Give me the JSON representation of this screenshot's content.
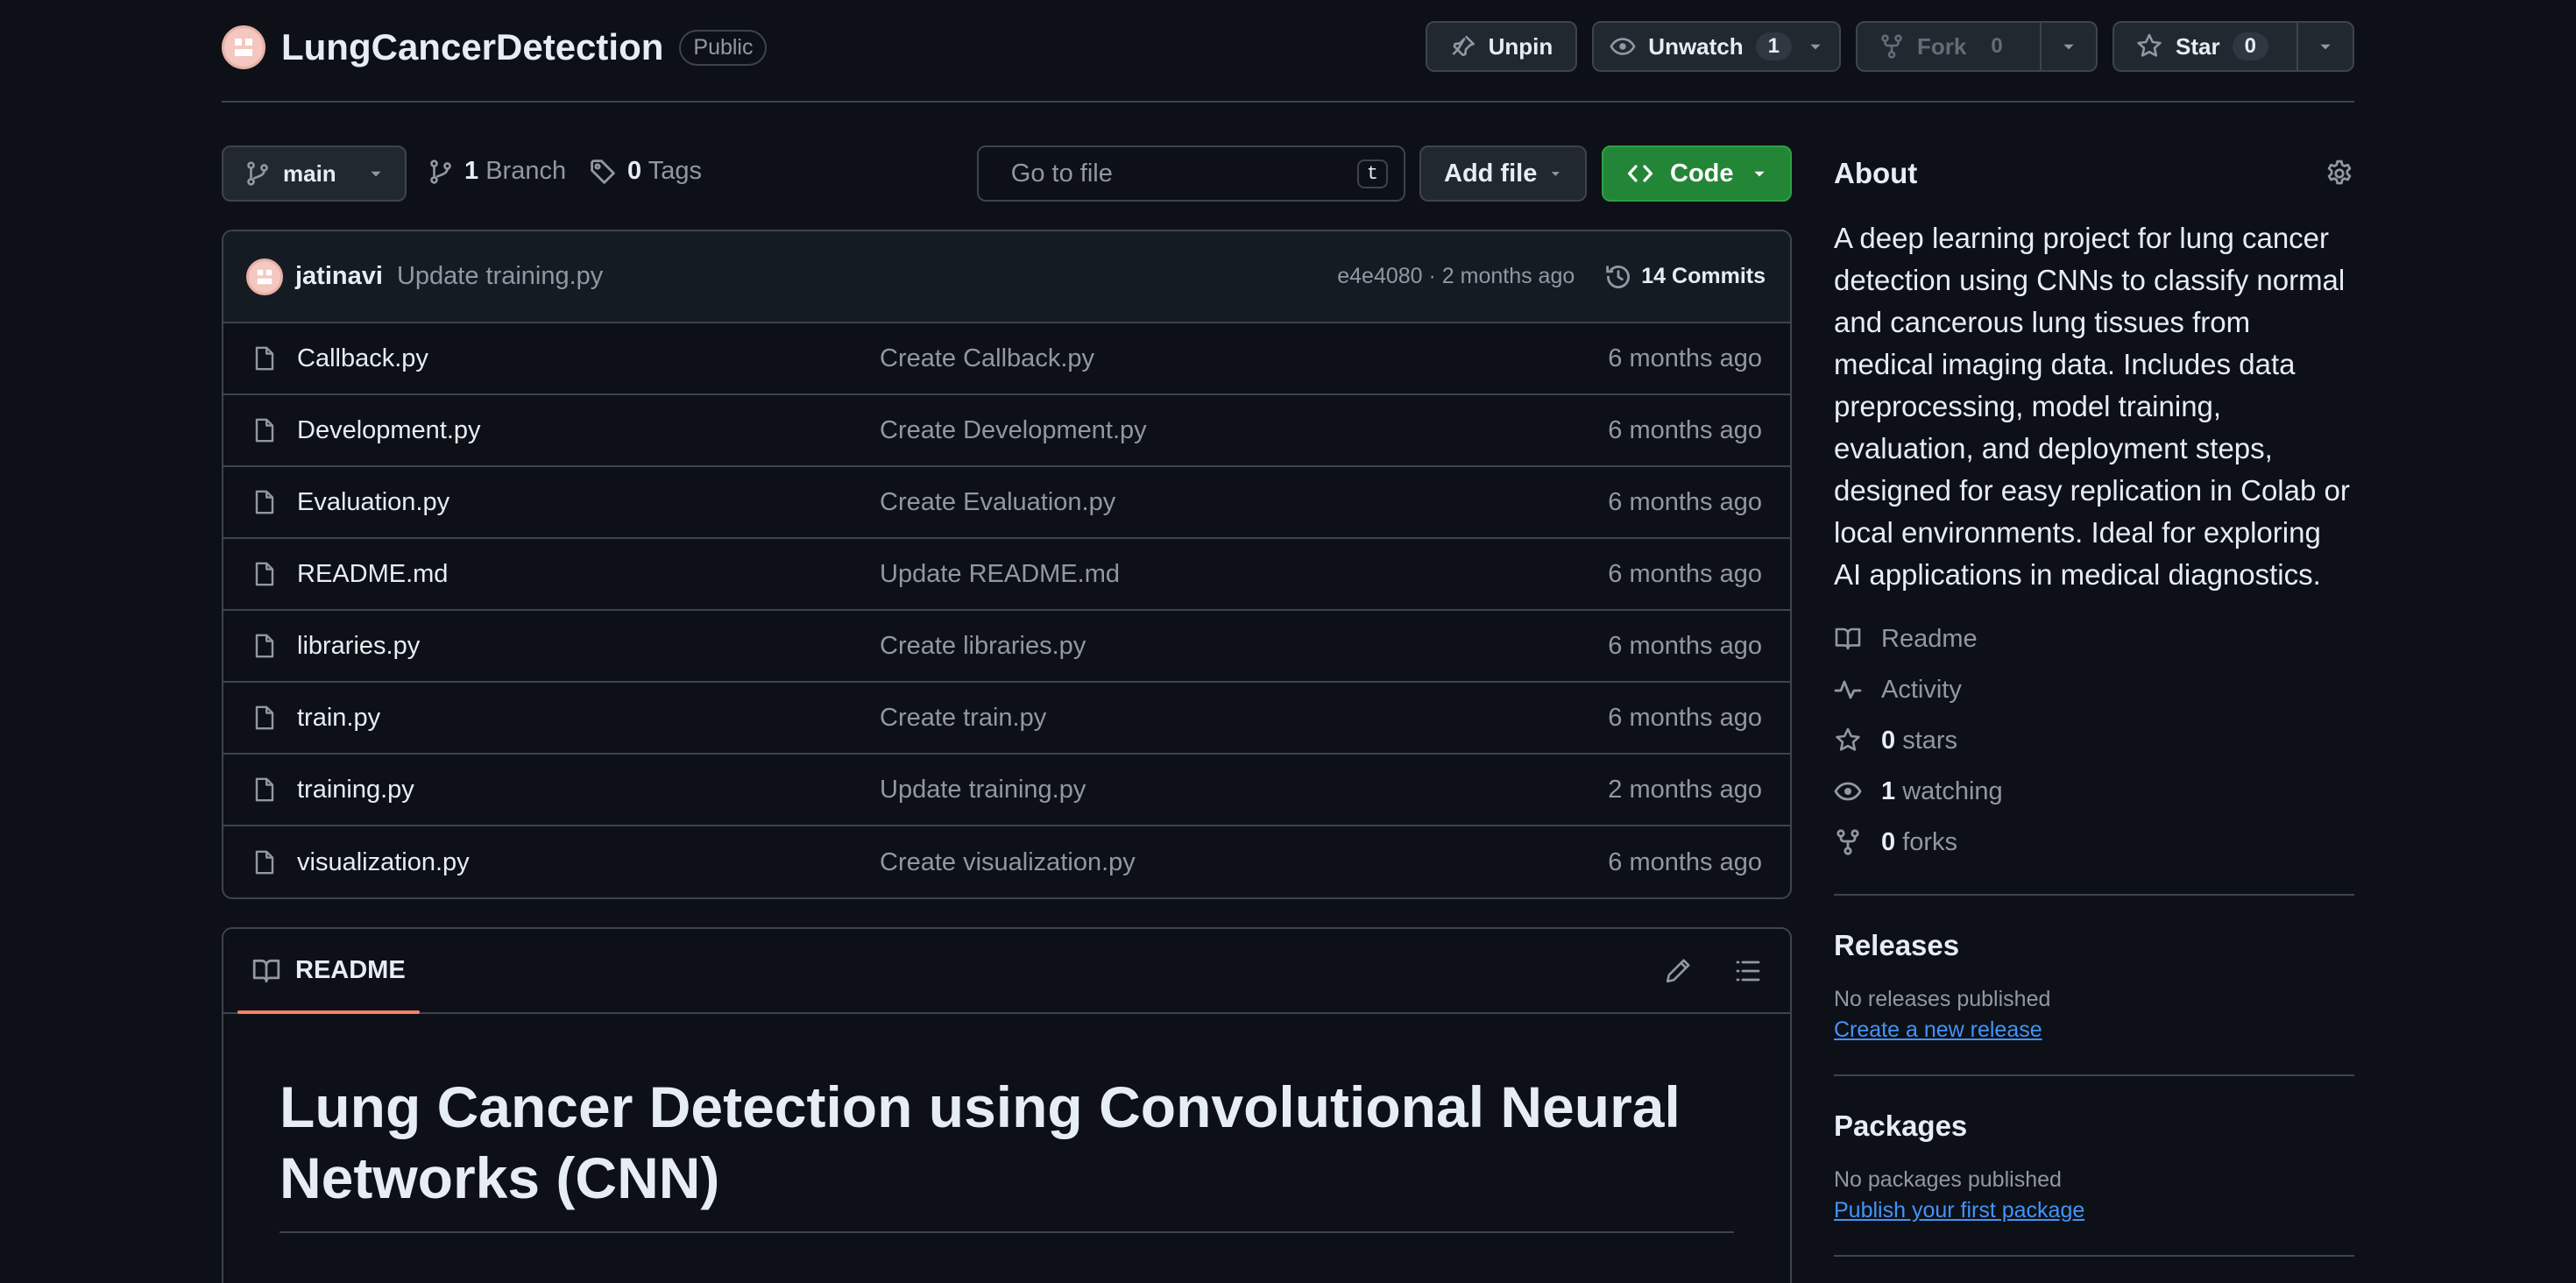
{
  "repo": {
    "name": "LungCancerDetection",
    "visibility": "Public"
  },
  "actions": {
    "unpin": "Unpin",
    "watch": "Unwatch",
    "watch_count": "1",
    "fork": "Fork",
    "fork_count": "0",
    "star": "Star",
    "star_count": "0"
  },
  "toolbar": {
    "branch": "main",
    "branch_count": "1",
    "branch_label": "Branch",
    "tag_count": "0",
    "tag_label": "Tags",
    "search_placeholder": "Go to file",
    "search_shortcut": "t",
    "add_file": "Add file",
    "code": "Code"
  },
  "latest_commit": {
    "author": "jatinavi",
    "message": "Update training.py",
    "meta": "e4e4080 · 2 months ago",
    "commits_label": "14 Commits"
  },
  "files": [
    {
      "name": "Callback.py",
      "message": "Create Callback.py",
      "age": "6 months ago"
    },
    {
      "name": "Development.py",
      "message": "Create Development.py",
      "age": "6 months ago"
    },
    {
      "name": "Evaluation.py",
      "message": "Create Evaluation.py",
      "age": "6 months ago"
    },
    {
      "name": "README.md",
      "message": "Update README.md",
      "age": "6 months ago"
    },
    {
      "name": "libraries.py",
      "message": "Create libraries.py",
      "age": "6 months ago"
    },
    {
      "name": "train.py",
      "message": "Create train.py",
      "age": "6 months ago"
    },
    {
      "name": "training.py",
      "message": "Update training.py",
      "age": "2 months ago"
    },
    {
      "name": "visualization.py",
      "message": "Create visualization.py",
      "age": "6 months ago"
    }
  ],
  "readme": {
    "tab": "README",
    "title": "Lung Cancer Detection using Convolutional Neural Networks (CNN)"
  },
  "about": {
    "heading": "About",
    "description": "A deep learning project for lung cancer detection using CNNs to classify normal and cancerous lung tissues from medical imaging data. Includes data preprocessing, model training, evaluation, and deployment steps, designed for easy replication in Colab or local environments. Ideal for exploring AI applications in medical diagnostics.",
    "readme_link": "Readme",
    "activity_link": "Activity",
    "stars_count": "0",
    "stars_label": "stars",
    "watching_count": "1",
    "watching_label": "watching",
    "forks_count": "0",
    "forks_label": "forks"
  },
  "releases": {
    "heading": "Releases",
    "empty": "No releases published",
    "action": "Create a new release"
  },
  "packages": {
    "heading": "Packages",
    "empty": "No packages published",
    "action": "Publish your first package"
  },
  "colors": {
    "background": "#0d1117",
    "border": "#3d444d",
    "code_button": "#238636",
    "link": "#4493f8",
    "readme_tab_accent": "#f78166"
  }
}
